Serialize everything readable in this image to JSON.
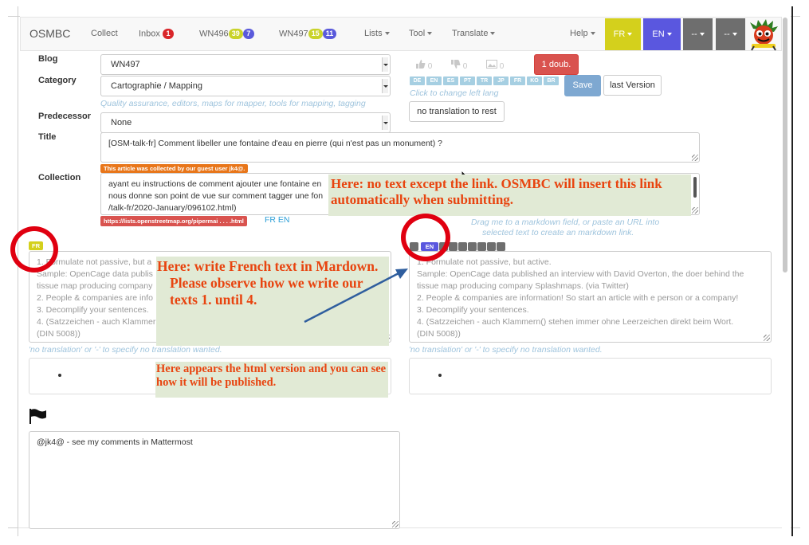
{
  "navbar": {
    "brand": "OSMBC",
    "collect": "Collect",
    "inbox": "Inbox",
    "inbox_count": "1",
    "wn496": "WN496",
    "wn496_count_a": "39",
    "wn496_count_b": "7",
    "wn497": "WN497",
    "wn497_count_a": "15",
    "wn497_count_b": "11",
    "lists": "Lists",
    "tool": "Tool",
    "translate": "Translate",
    "help": "Help",
    "lang_fr": "FR",
    "lang_en": "EN",
    "lang_x1": "--",
    "lang_x2": "--"
  },
  "form": {
    "blog_label": "Blog",
    "blog_value": "WN497",
    "category_label": "Category",
    "category_value": "Cartographie / Mapping",
    "category_hint": "Quality assurance, editors, maps for mapper, tools for mapping, tagging",
    "predecessor_label": "Predecessor",
    "predecessor_value": "None",
    "title_label": "Title",
    "title_value": "[OSM-talk-fr] Comment libeller une fontaine d'eau en pierre (qui n'est pas un monument) ?",
    "collection_label": "Collection",
    "collected_by": "This article was collected by our guest user jk4@.",
    "collection_line1": "ayant eu instructions de comment ajouter une fontaine en",
    "collection_line2": "nous donne son point de vue sur comment tagger une fon",
    "collection_line3": "/talk-fr/2020-January/096102.html)",
    "link_tag": "https://lists.openstreetmap.org/pipermai . . . .html",
    "link_langs": "FR EN",
    "drag_hint_1": "Drag me to a markdown field, or paste an URL into",
    "drag_hint_2": "selected text to create an markdown link."
  },
  "side": {
    "votes_a": "0",
    "votes_b": "0",
    "votes_c": "0",
    "doubt_button": "1 doub.",
    "langs": [
      "DE",
      "EN",
      "ES",
      "PT",
      "TR",
      "JP",
      "FR",
      "KO",
      "BR"
    ],
    "change_lang_hint": "Click to change left lang",
    "save_button": "Save",
    "last_version_button": "last Version",
    "no_translation_button": "no translation to rest"
  },
  "editor": {
    "left_tag": "FR",
    "right_tag": "EN",
    "left_placeholder": [
      "1. Formulate not passive, but a",
      "Sample: OpenCage data publis",
      "tissue map producing company",
      "2. People & companies are info",
      "3. Decomplify your sentences.",
      "4. (Satzzeichen - auch Klammer",
      "(DIN 5008))"
    ],
    "right_placeholder": [
      "1. Formulate not passive, but active.",
      "Sample: OpenCage data published an interview with David Overton, the doer behind the",
      "tissue map producing company Splashmaps. (via Twitter)",
      "2. People & companies are information! So start an article with e person or a company!",
      "3. Decomplify your sentences.",
      "4. (Satzzeichen - auch Klammern() stehen immer ohne Leerzeichen direkt beim Wort.",
      "(DIN 5008))"
    ],
    "no_translation_hint": "'no translation' or '-' to specify no translation wanted."
  },
  "comment": {
    "value": "@jk4@ - see my comments in Mattermost"
  },
  "notes": {
    "collection_note": "Here: no text except the link. OSMBC will insert this link automatically when submitting.",
    "markdown_note_1": "Here: write French text in Mardown.",
    "markdown_note_2": "Please observe how we write our texts 1. until 4.",
    "html_note": "Here appears the html version and you can see how it will be published."
  },
  "colors": {
    "inbox_badge": "#d9262a",
    "count_a": "#c9d32b",
    "count_b": "#5a5adb",
    "fr_button": "#d4d01c",
    "en_button": "#5a57df",
    "grey_button": "#6e6e6e",
    "doubt_button": "#d9534f",
    "note_text": "#e8440f",
    "note_bg": "#e1ead5",
    "ring": "#e00010"
  }
}
